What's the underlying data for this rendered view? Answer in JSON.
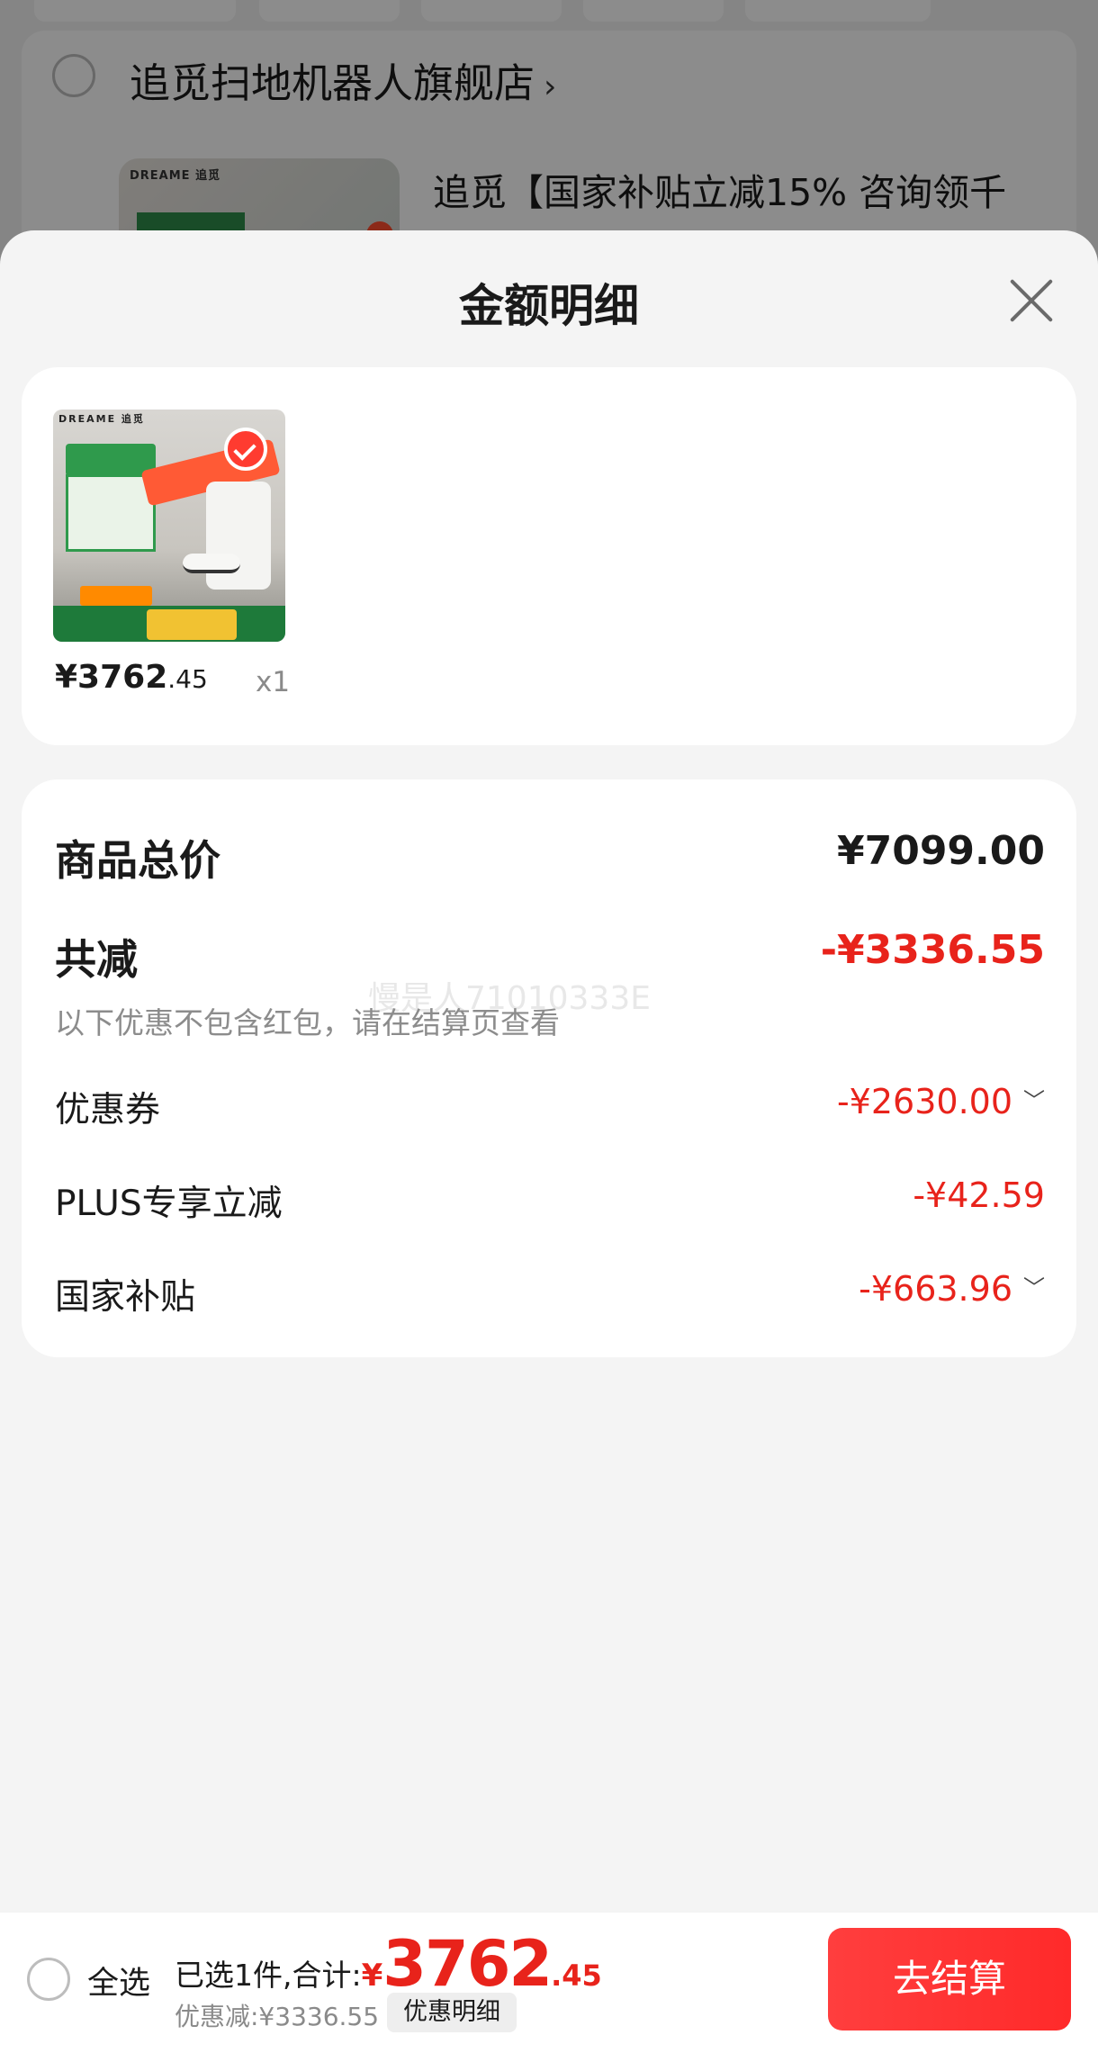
{
  "background": {
    "store_name": "追觅扫地机器人旗舰店",
    "store_arrow": "›",
    "product_title": "追觅【国家补贴立减15% 咨询领千",
    "thumb_brand": "DREAME 追觅"
  },
  "sheet": {
    "title": "金额明细",
    "close_icon": "close-icon"
  },
  "goods": {
    "image_brand": "DREAME 追觅",
    "price_int": "¥3762",
    "price_dec": ".45",
    "qty": "x1"
  },
  "detail": {
    "total_label": "商品总价",
    "total_value": "¥7099.00",
    "reduce_label": "共减",
    "reduce_value": "-¥3336.55",
    "hint": "以下优惠不包含红包，请在结算页查看",
    "watermark": "慢是人71010333E",
    "items": [
      {
        "label": "优惠券",
        "value": "-¥2630.00",
        "has_chevron": true
      },
      {
        "label": "PLUS专享立减",
        "value": "-¥42.59",
        "has_chevron": false
      },
      {
        "label": "国家补贴",
        "value": "-¥663.96",
        "has_chevron": true
      }
    ],
    "chevron": "﹀"
  },
  "bottom": {
    "select_all": "全选",
    "summary_text": "已选1件,合计:",
    "currency": "¥",
    "total_int": "3762",
    "total_dec": ".45",
    "discount_text": "优惠减:¥3336.55",
    "discount_button": "优惠明细",
    "checkout": "去结算"
  },
  "colors": {
    "accent_red": "#e8231b",
    "checkout_red": "#ff3030",
    "text": "#1a1a1a",
    "muted": "#8c8c8c"
  }
}
